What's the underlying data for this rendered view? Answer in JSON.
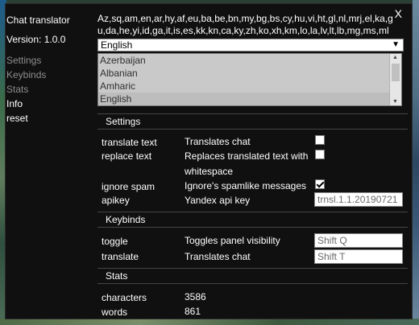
{
  "app": {
    "title": "Chat translator",
    "version": "Version: 1.0.0",
    "close": "X"
  },
  "nav": [
    "Settings",
    "Keybinds",
    "Stats",
    "Info",
    "reset"
  ],
  "languages": {
    "codes": "Az,sq,am,en,ar,hy,af,eu,ba,be,bn,my,bg,bs,cy,hu,vi,ht,gl,nl,mrj,el,ka,gu,da,he,yi,id,ga,it,is,es,kk,kn,ca,ky,zh,ko,xh,km,lo,la,lv,lt,lb,mg,ms,ml",
    "selected": "English",
    "options": [
      "Azerbaijan",
      "Albanian",
      "Amharic",
      "English"
    ]
  },
  "sections": {
    "settings": "Settings",
    "keybinds": "Keybinds",
    "stats": "Stats"
  },
  "settings": {
    "translate_text": {
      "label": "translate text",
      "desc": "Translates chat",
      "checked": false
    },
    "replace_text": {
      "label": "replace text",
      "desc1": "Replaces translated text with",
      "desc2": "whitespace",
      "checked": false
    },
    "ignore_spam": {
      "label": "ignore spam",
      "desc": "Ignore's spamlike messages",
      "checked": true
    },
    "apikey": {
      "label": "apikey",
      "desc": "Yandex api key",
      "value": "trnsl.1.1.20190721"
    }
  },
  "keybinds": {
    "toggle": {
      "label": "toggle",
      "desc": "Toggles panel visibility",
      "value": "Shift Q"
    },
    "translate": {
      "label": "translate",
      "desc": "Translates chat",
      "value": "Shift T"
    }
  },
  "stats": {
    "characters": {
      "label": "characters",
      "value": "3586"
    },
    "words": {
      "label": "words",
      "value": "861"
    }
  }
}
